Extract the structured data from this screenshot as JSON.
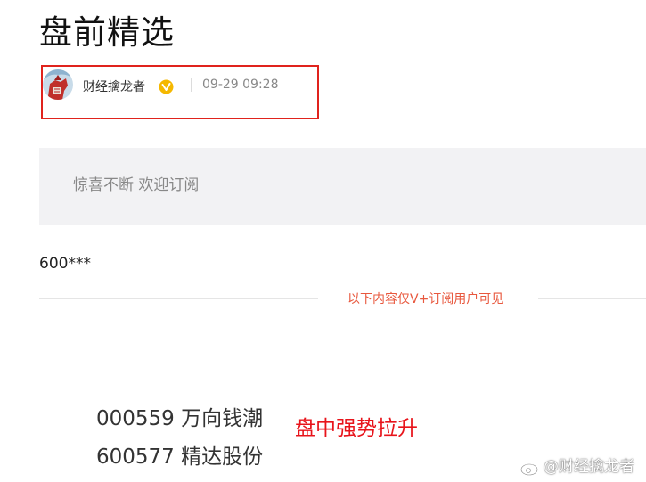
{
  "article": {
    "title": "盘前精选",
    "author": {
      "name": "财经擒龙者",
      "verified_icon": "v-verified-badge-icon",
      "published": "09-29 09:28"
    },
    "subscribe_banner": "惊喜不断 欢迎订阅",
    "visible_code": "600***",
    "paywall_divider": "以下内容仅V+订阅用户可见",
    "stocks": [
      {
        "line": "000559 万向钱潮"
      },
      {
        "line": "600577 精达股份"
      }
    ],
    "note": "盘中强势拉升",
    "watermark": "@财经擒龙者"
  },
  "colors": {
    "highlight_box": "#e0231d",
    "divider_text": "#e8583e",
    "note_text": "#e8141b",
    "verified_badge": "#f5b800"
  }
}
